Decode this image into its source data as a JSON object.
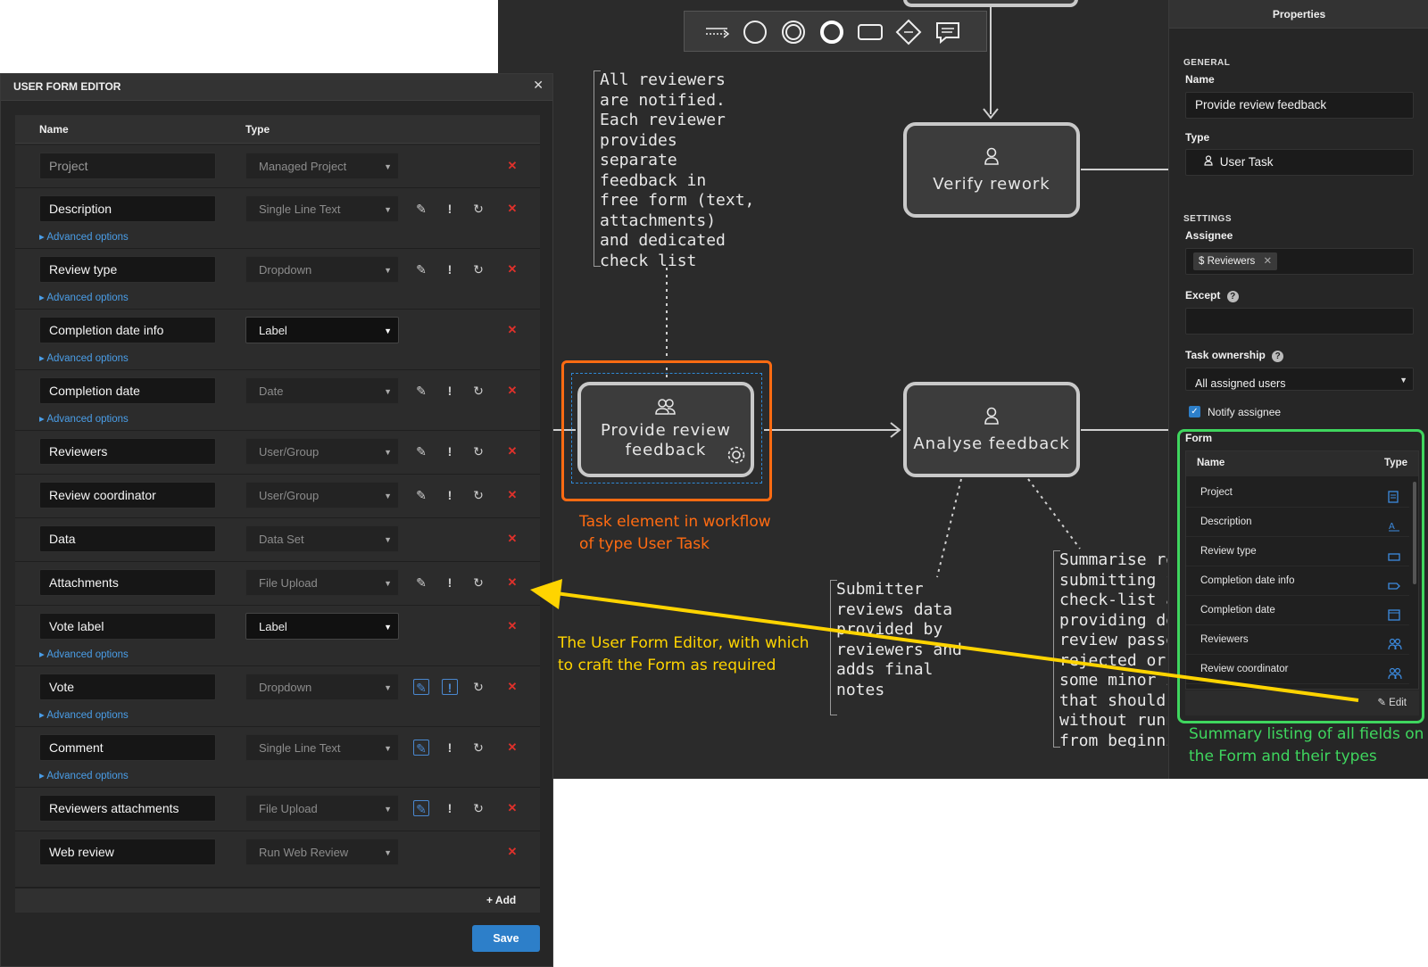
{
  "canvas": {
    "nodes": {
      "verify": "Verify rework",
      "provide": "Provide review\nfeedback",
      "analyse": "Analyse feedback"
    },
    "notes": {
      "reviewers": "All reviewers\nare notified.\nEach reviewer\nprovides\nseparate\nfeedback in\nfree form (text,\nattachments)\nand dedicated\ncheck list",
      "submitter": "Submitter\nreviews data\nprovided by\nreviewers and\nadds final\nnotes",
      "summarise": "Summarise re\nsubmitting fo\ncheck-list an\nproviding dec\nreview passe\nrejected or th\nsome minor i\nthat should b\nwithout runni\nfrom beginni"
    },
    "captions": {
      "task": "Task element in workflow\nof type User Task",
      "editor": "The User Form Editor, with which\nto craft the Form as required",
      "summary": "Summary listing of all fields on\nthe Form and their types"
    },
    "colors": {
      "task": "#ff6b12",
      "editor": "#ffd400",
      "summary": "#3fd65e"
    }
  },
  "properties": {
    "title": "Properties",
    "general_label": "GENERAL",
    "name_label": "Name",
    "name_value": "Provide review feedback",
    "type_label": "Type",
    "type_value": "User Task",
    "settings_label": "SETTINGS",
    "assignee_label": "Assignee",
    "assignee_chip": "$ Reviewers",
    "except_label": "Except",
    "ownership_label": "Task ownership",
    "ownership_value": "All assigned users",
    "notify_label": "Notify assignee",
    "form": {
      "label": "Form",
      "col_name": "Name",
      "col_type": "Type",
      "rows": [
        "Project",
        "Description",
        "Review type",
        "Completion date info",
        "Completion date",
        "Reviewers",
        "Review coordinator"
      ],
      "edit_label": "Edit"
    }
  },
  "editor": {
    "title": "USER FORM EDITOR",
    "col_name": "Name",
    "col_type": "Type",
    "advanced_label": "Advanced options",
    "add_label": "Add",
    "save_label": "Save",
    "rows": [
      {
        "name": "Project",
        "type": "Managed Project"
      },
      {
        "name": "Description",
        "type": "Single Line Text"
      },
      {
        "name": "Review type",
        "type": "Dropdown"
      },
      {
        "name": "Completion date info",
        "type": "Label"
      },
      {
        "name": "Completion date",
        "type": "Date"
      },
      {
        "name": "Reviewers",
        "type": "User/Group"
      },
      {
        "name": "Review coordinator",
        "type": "User/Group"
      },
      {
        "name": "Data",
        "type": "Data Set"
      },
      {
        "name": "Attachments",
        "type": "File Upload"
      },
      {
        "name": "Vote label",
        "type": "Label"
      },
      {
        "name": "Vote",
        "type": "Dropdown"
      },
      {
        "name": "Comment",
        "type": "Single Line Text"
      },
      {
        "name": "Reviewers attachments",
        "type": "File Upload"
      },
      {
        "name": "Web review",
        "type": "Run Web Review"
      }
    ]
  }
}
